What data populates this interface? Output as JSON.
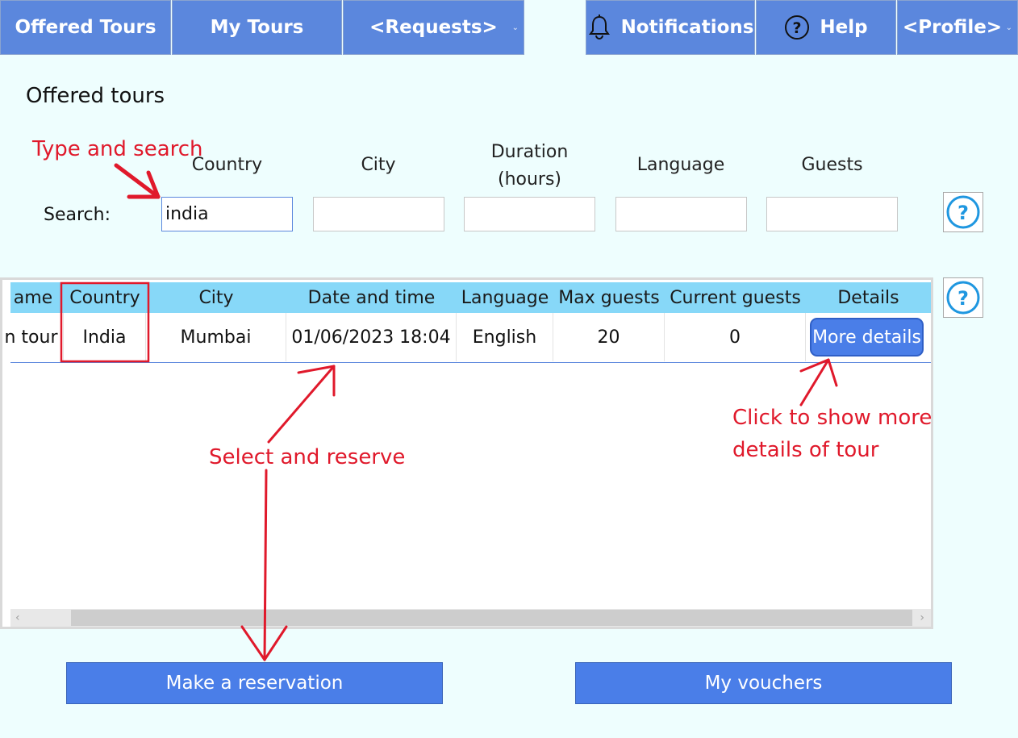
{
  "nav": {
    "offered_tours": "Offered Tours",
    "my_tours": "My Tours",
    "requests": "<Requests>",
    "notifications": "Notifications",
    "help": "Help",
    "profile": "<Profile>"
  },
  "page_title": "Offered tours",
  "search": {
    "label": "Search:",
    "columns": {
      "country": "Country",
      "city": "City",
      "duration_line1": "Duration",
      "duration_line2": "(hours)",
      "language": "Language",
      "guests": "Guests"
    },
    "values": {
      "country": "india",
      "city": "",
      "duration": "",
      "language": "",
      "guests": ""
    }
  },
  "table": {
    "headers": [
      "ame",
      "Country",
      "City",
      "Date and time",
      "Language",
      "Max guests",
      "Current guests",
      "Details"
    ],
    "rows": [
      {
        "name": "n tour",
        "country": "India",
        "city": "Mumbai",
        "datetime": "01/06/2023 18:04",
        "language": "English",
        "max_guests": "20",
        "current_guests": "0",
        "details_button": "More details"
      }
    ],
    "scroll_left": "‹",
    "scroll_right": "›"
  },
  "buttons": {
    "make_reservation": "Make a reservation",
    "my_vouchers": "My vouchers"
  },
  "annotations": {
    "type_and_search": "Type and search",
    "select_and_reserve": "Select and reserve",
    "click_line1": "Click to show more",
    "click_line2": "details of tour"
  },
  "colors": {
    "background": "#eefefe",
    "nav": "#5b87dd",
    "header": "#87d8f8",
    "button": "#4a7ee8",
    "annotation": "#e0192b"
  }
}
